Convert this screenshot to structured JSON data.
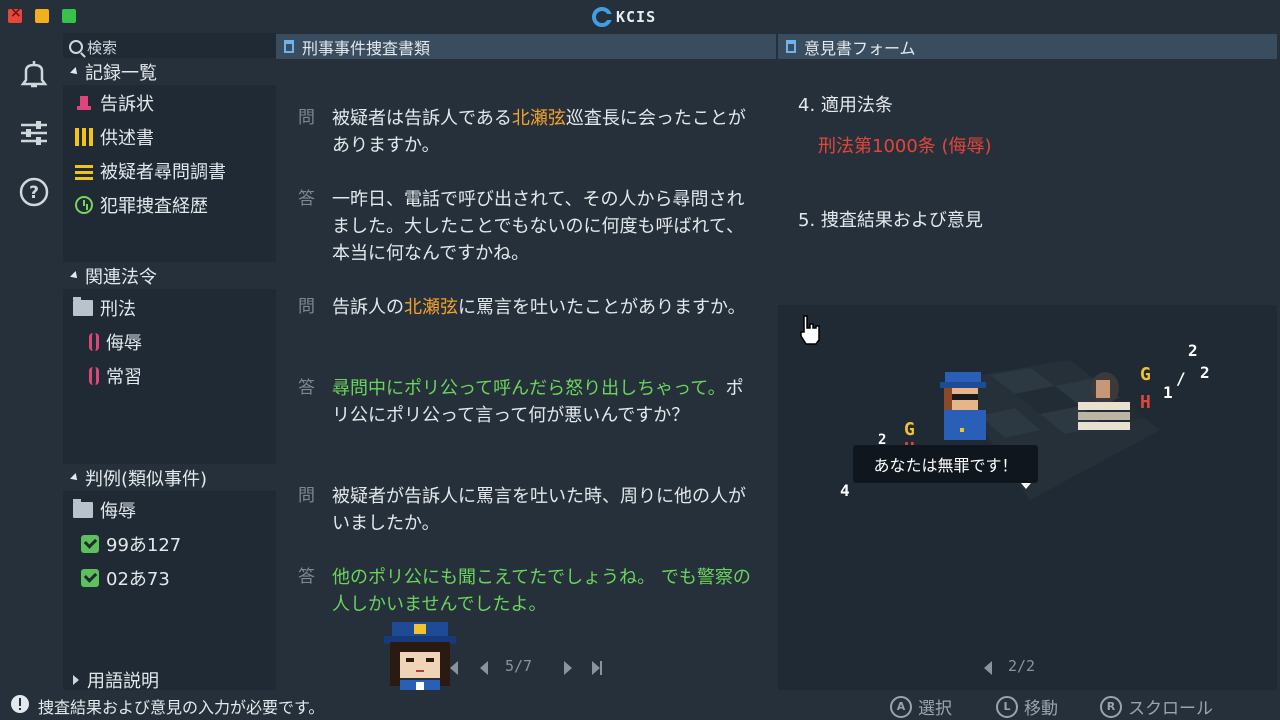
{
  "window": {
    "title": "KCIS",
    "accent": "#3f9ee6"
  },
  "sidebar": {
    "search_label": "検索",
    "records_title": "記録一覧",
    "records": [
      {
        "label": "告訴状",
        "icon": "complaint-icon"
      },
      {
        "label": "供述書",
        "icon": "statement-icon"
      },
      {
        "label": "被疑者尋問調書",
        "icon": "interrogation-icon"
      },
      {
        "label": "犯罪捜査経歴",
        "icon": "history-icon"
      }
    ],
    "laws_title": "関連法令",
    "laws_folder": "刑法",
    "laws": [
      "侮辱",
      "常習"
    ],
    "cases_title": "判例(類似事件)",
    "cases_folder": "侮辱",
    "cases": [
      "99あ127",
      "02あ73"
    ],
    "glossary_title": "用語説明"
  },
  "document": {
    "header": "刑事事件捜査書類",
    "qa": [
      {
        "mark": "問",
        "parts": [
          "被疑者は告訴人である",
          "北瀬弦",
          "巡査長に会ったことがありますか。"
        ]
      },
      {
        "mark": "答",
        "parts": [
          "一昨日、電話で呼び出されて、その人から尋問されました。大したことでもないのに何度も呼ばれて、本当に何なんですかね。"
        ]
      },
      {
        "mark": "問",
        "parts": [
          "告訴人の",
          "北瀬弦",
          "に罵言を吐いたことがありますか。"
        ]
      },
      {
        "mark": "答",
        "parts": [
          "尋問中にポリ公って呼んだら怒り出しちゃって。",
          "ポリ公にポリ公って言って何が悪いんですか？"
        ]
      },
      {
        "mark": "問",
        "parts": [
          "被疑者が告訴人に罵言を吐いた時、周りに他の人がいましたか。"
        ]
      },
      {
        "mark": "答",
        "parts": [
          "他のポリ公にも聞こえてたでしょうね。 でも警察の人しかいませんでしたよ。"
        ]
      }
    ],
    "page": "5/7"
  },
  "opinion": {
    "header": "意見書フォーム",
    "item4": "4. 適用法条",
    "item4_value": "刑法第1000条 (侮辱)",
    "item5": "5. 捜査結果および意見",
    "speech": "あなたは無罪です！",
    "page": "2/2"
  },
  "status": {
    "message": "捜査結果および意見の入力が必要です。",
    "controls": [
      {
        "key": "A",
        "label": "選択"
      },
      {
        "key": "L",
        "label": "移動"
      },
      {
        "key": "R",
        "label": "スクロール"
      }
    ]
  }
}
